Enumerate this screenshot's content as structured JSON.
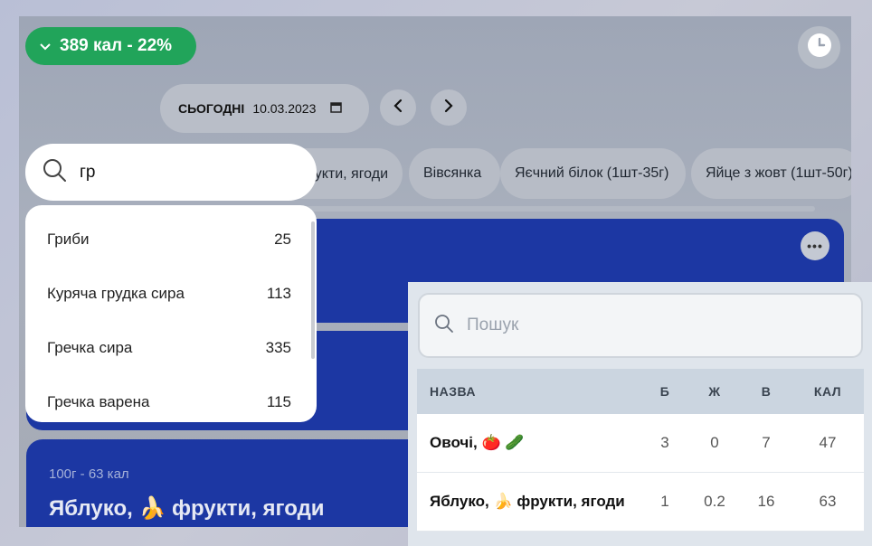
{
  "header": {
    "calorie_badge": "389 кал - 22%",
    "today_label": "СЬОГОДНІ",
    "date_value": "10.03.2023"
  },
  "chips": [
    "Яблуко, 🍌 фрукти, ягоди",
    "Вівсянка",
    "Яєчний білок (1шт-35г)",
    "Яйце з жовт (1шт-50г)"
  ],
  "search": {
    "value": "гр"
  },
  "suggestions": [
    {
      "name": "Гриби",
      "cal": "25"
    },
    {
      "name": "Куряча грудка сира",
      "cal": "113"
    },
    {
      "name": "Гречка сира",
      "cal": "335"
    },
    {
      "name": "Гречка варена",
      "cal": "115"
    }
  ],
  "entries": [
    {
      "sub": "100г - 63 кал",
      "title": "Яблуко, 🍌 фрукти, ягоди"
    }
  ],
  "panel": {
    "search_placeholder": "Пошук",
    "columns": {
      "name": "НАЗВА",
      "b": "Б",
      "z": "Ж",
      "v": "В",
      "kal": "КАЛ"
    },
    "rows": [
      {
        "name": "Овочі, 🍅 🥒",
        "b": "3",
        "z": "0",
        "v": "7",
        "kal": "47"
      },
      {
        "name": "Яблуко, 🍌 фрукти, ягоди",
        "b": "1",
        "z": "0.2",
        "v": "16",
        "kal": "63"
      }
    ]
  },
  "colors": {
    "accent_green": "#21a45a",
    "card_blue": "#1c37a3"
  },
  "icons": [
    "chevron-down-icon",
    "clock-icon",
    "calendar-icon",
    "chevron-left-icon",
    "chevron-right-icon",
    "search-icon",
    "more-icon"
  ]
}
